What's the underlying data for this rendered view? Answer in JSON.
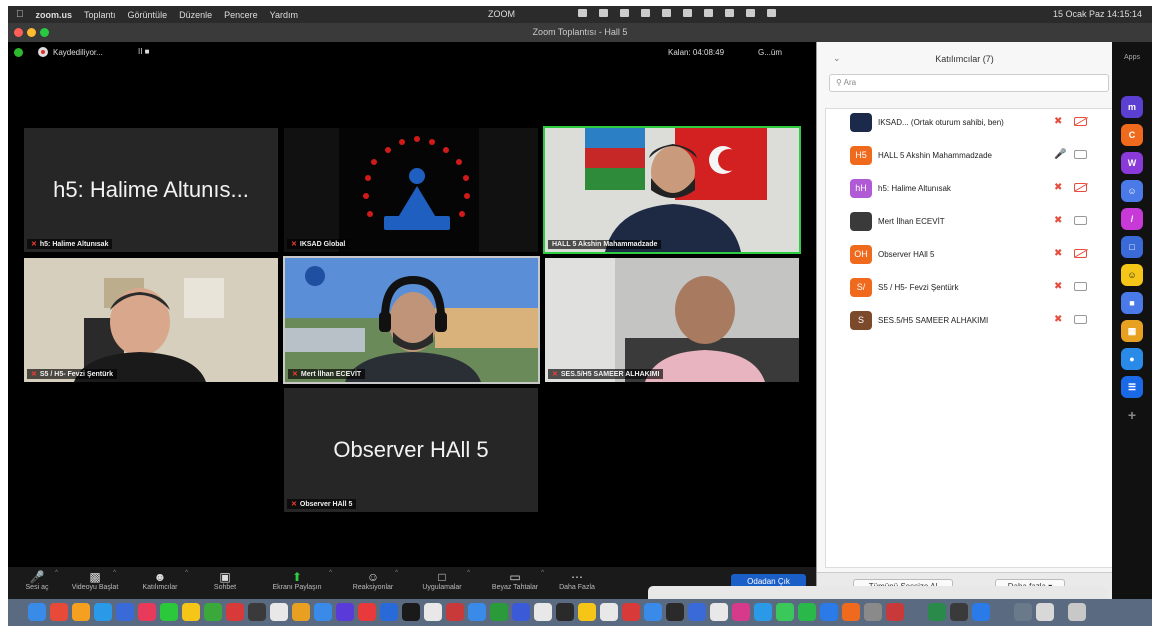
{
  "menubar": {
    "app": "zoom.us",
    "items": [
      "Toplantı",
      "Görüntüle",
      "Düzenle",
      "Pencere",
      "Yardım"
    ],
    "center_label": "ZOOM",
    "datetime": "15 Ocak Paz  14:15:14"
  },
  "window": {
    "title": "Zoom Toplantısı - Hall 5"
  },
  "meeting_bar": {
    "recording_label": "Kaydediliyor...",
    "recording_controls": "II ■",
    "timer": "Kalan: 04:08:49",
    "view_label": "G...üm"
  },
  "tiles": [
    {
      "name": "h5: Halime Altunısak",
      "big_label": "h5: Halime Altunıs...",
      "type": "name",
      "muted": true
    },
    {
      "name": "IKSAD Global",
      "type": "logo",
      "muted": true
    },
    {
      "name": "HALL 5 Akshin Mahammadzade",
      "type": "video",
      "muted": false,
      "active": true
    },
    {
      "name": "S5 / H5- Fevzi Şentürk",
      "type": "video",
      "muted": true
    },
    {
      "name": "Mert İlhan ECEVİT",
      "type": "video",
      "muted": true,
      "spotlight": true
    },
    {
      "name": "SES.5/H5 SAMEER ALHAKIMI",
      "type": "video",
      "muted": true
    },
    {
      "name": "Observer HAll 5",
      "big_label": "Observer HAll 5",
      "type": "name",
      "muted": true
    }
  ],
  "toolbar": {
    "buttons": [
      {
        "label": "Sesi aç",
        "icon": "mic-icon",
        "caret": true
      },
      {
        "label": "Videoyu Başlat",
        "icon": "video-icon",
        "caret": true
      },
      {
        "label": "Katılımcılar",
        "icon": "participants-icon",
        "caret": true
      },
      {
        "label": "Sohbet",
        "icon": "chat-icon",
        "caret": false
      },
      {
        "label": "Ekranı Paylaşın",
        "icon": "share-screen-icon",
        "caret": true,
        "green": true
      },
      {
        "label": "Reaksiyonlar",
        "icon": "reactions-icon",
        "caret": true
      },
      {
        "label": "Uygulamalar",
        "icon": "apps-icon",
        "caret": true
      },
      {
        "label": "Beyaz Tahtalar",
        "icon": "whiteboard-icon",
        "caret": true
      },
      {
        "label": "Daha Fazla",
        "icon": "more-icon",
        "caret": false
      }
    ],
    "leave_label": "Odadan Çık"
  },
  "participants_panel": {
    "title": "Katılımcılar (7)",
    "search_placeholder": "Ara",
    "participants": [
      {
        "name": "IKSAD... (Ortak oturum sahibi, ben)",
        "initials": "",
        "avatar_color": "#1b2a4a",
        "mic": "off",
        "cam": "off"
      },
      {
        "name": "HALL 5 Akshin Mahammadzade",
        "initials": "H5",
        "avatar_color": "#f06a1d",
        "mic": "on",
        "cam": "on"
      },
      {
        "name": "h5: Halime Altunısak",
        "initials": "hH",
        "avatar_color": "#b05ad6",
        "mic": "off",
        "cam": "off"
      },
      {
        "name": "Mert İlhan ECEVİT",
        "initials": "",
        "avatar_color": "#3a3a3a",
        "mic": "off",
        "cam": "on"
      },
      {
        "name": "Observer HAll 5",
        "initials": "OH",
        "avatar_color": "#f06a1d",
        "mic": "off",
        "cam": "off"
      },
      {
        "name": "S5 / H5- Fevzi Şentürk",
        "initials": "S/",
        "avatar_color": "#f06a1d",
        "mic": "off",
        "cam": "on"
      },
      {
        "name": "SES.5/H5 SAMEER ALHAKIMI",
        "initials": "S",
        "avatar_color": "#7a4a2a",
        "mic": "off",
        "cam": "on"
      }
    ],
    "footer": {
      "mute_all_label": "Tümünü Sessize Al",
      "more_label": "Daha fazla ▾"
    }
  },
  "apps_sidebar": {
    "title": "Apps"
  }
}
